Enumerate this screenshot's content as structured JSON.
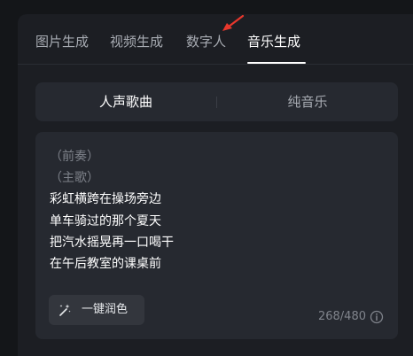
{
  "tabs": [
    {
      "label": "图片生成",
      "active": false
    },
    {
      "label": "视频生成",
      "active": false
    },
    {
      "label": "数字人",
      "active": false
    },
    {
      "label": "音乐生成",
      "active": true
    }
  ],
  "mode_switch": {
    "options": [
      "人声歌曲",
      "纯音乐"
    ],
    "selected": "人声歌曲"
  },
  "lyrics_editor": {
    "lines": [
      {
        "text": "（前奏）",
        "muted": true
      },
      {
        "text": "（主歌）",
        "muted": true
      },
      {
        "text": "彩虹横跨在操场旁边",
        "muted": false
      },
      {
        "text": "单车骑过的那个夏天",
        "muted": false
      },
      {
        "text": "把汽水摇晃再一口喝干",
        "muted": false
      },
      {
        "text": "在午后教室的课桌前",
        "muted": false
      }
    ],
    "polish_button_label": "一键润色",
    "char_count": "268/480"
  },
  "icons": {
    "polish": "magic-wand-icon",
    "info": "info-icon",
    "annotation": "red-arrow-icon"
  },
  "colors": {
    "background": "#141619",
    "panel": "#1c1e23",
    "card": "#262930",
    "active_text": "#ffffff",
    "inactive_text": "#a7abb2",
    "annotation_arrow": "#e8372c"
  }
}
